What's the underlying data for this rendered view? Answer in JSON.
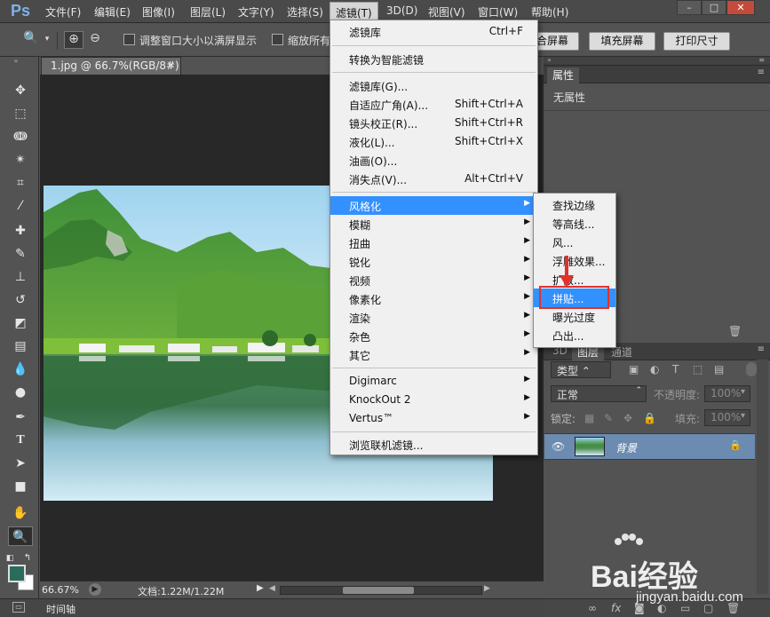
{
  "app": {
    "logo": "Ps"
  },
  "menubar": {
    "items": [
      "文件(F)",
      "编辑(E)",
      "图像(I)",
      "图层(L)",
      "文字(Y)",
      "选择(S)",
      "滤镜(T)",
      "3D(D)",
      "视图(V)",
      "窗口(W)",
      "帮助(H)"
    ],
    "active": "滤镜(T)",
    "window_buttons": {
      "minimize": "–",
      "restore": "□",
      "close": "✕"
    }
  },
  "options_bar": {
    "resize_windows_label": "调整窗口大小以满屏显示",
    "zoom_all_label": "缩放所有",
    "fill_screen_partial": "合屏幕",
    "fill_screen_button": "填充屏幕",
    "print_size_button": "打印尺寸"
  },
  "document": {
    "tab_title": "1.jpg @ 66.7%(RGB/8#)",
    "close_glyph": "✕"
  },
  "status": {
    "zoom": "66.67%",
    "doc_info": "文档:1.22M/1.22M",
    "timeline": "时间轴"
  },
  "filter_menu": {
    "items": [
      {
        "label": "滤镜库",
        "shortcut": "Ctrl+F"
      },
      {
        "label": "转换为智能滤镜",
        "shortcut": ""
      },
      {
        "label": "滤镜库(G)...",
        "shortcut": ""
      },
      {
        "label": "自适应广角(A)...",
        "shortcut": "Shift+Ctrl+A"
      },
      {
        "label": "镜头校正(R)...",
        "shortcut": "Shift+Ctrl+R"
      },
      {
        "label": "液化(L)...",
        "shortcut": "Shift+Ctrl+X"
      },
      {
        "label": "油画(O)...",
        "shortcut": ""
      },
      {
        "label": "消失点(V)...",
        "shortcut": "Alt+Ctrl+V"
      },
      {
        "label": "风格化",
        "shortcut": ""
      },
      {
        "label": "模糊",
        "shortcut": ""
      },
      {
        "label": "扭曲",
        "shortcut": ""
      },
      {
        "label": "锐化",
        "shortcut": ""
      },
      {
        "label": "视频",
        "shortcut": ""
      },
      {
        "label": "像素化",
        "shortcut": ""
      },
      {
        "label": "渲染",
        "shortcut": ""
      },
      {
        "label": "杂色",
        "shortcut": ""
      },
      {
        "label": "其它",
        "shortcut": ""
      },
      {
        "label": "Digimarc",
        "shortcut": ""
      },
      {
        "label": "KnockOut 2",
        "shortcut": ""
      },
      {
        "label": "Vertus™",
        "shortcut": ""
      },
      {
        "label": "浏览联机滤镜...",
        "shortcut": ""
      }
    ],
    "highlighted": "风格化"
  },
  "stylize_menu": {
    "items": [
      "查找边缘",
      "等高线...",
      "风...",
      "浮雕效果...",
      "扩散...",
      "拼贴...",
      "曝光过度",
      "凸出..."
    ],
    "highlighted": "拼贴...",
    "annotation_color": "#e0312a"
  },
  "properties_panel": {
    "tab": "属性",
    "empty_text": "无属性"
  },
  "layers_panel": {
    "tabs": [
      "3D",
      "图层",
      "通道"
    ],
    "active_tab": "图层",
    "filter_kind": "类型",
    "blend_mode": "正常",
    "opacity_label": "不透明度:",
    "opacity_value": "100%",
    "lock_label": "锁定:",
    "fill_label": "填充:",
    "fill_value": "100%",
    "layers": [
      {
        "name": "背景",
        "locked": true,
        "visible": true
      }
    ]
  },
  "watermark": {
    "brand": "Bai经验",
    "url": "jingyan.baidu.com"
  },
  "colors": {
    "menu_highlight": "#3390ff",
    "foreground_swatch": "#2b6b5c",
    "background_swatch": "#ffffff"
  }
}
